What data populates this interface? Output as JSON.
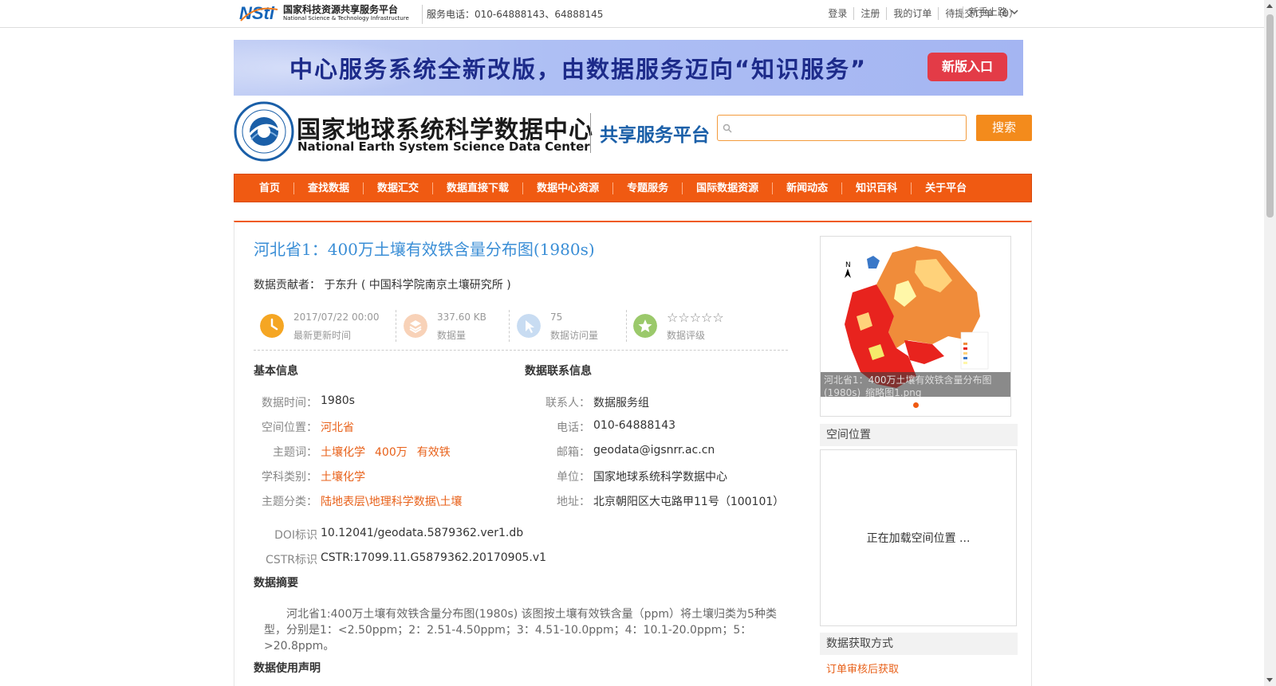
{
  "topbar": {
    "nsti_name_cn": "国家科技资源共享服务平台",
    "nsti_name_en": "National Science & Technology Infrastructure",
    "service_phone": "服务电话：010-64888143、64888145",
    "links": [
      "登录",
      "注册",
      "我的订单",
      "待提交订单（0）"
    ],
    "newbie": "新手上路"
  },
  "banner": {
    "text": "中心服务系统全新改版，由数据服务迈向“知识服务”",
    "button": "新版入口"
  },
  "header": {
    "title_cn": "国家地球系统科学数据中心",
    "title_en": "National Earth System Science Data Center",
    "platform": "共享服务平台",
    "search_placeholder": "",
    "search_button": "搜索"
  },
  "nav": [
    "首页",
    "查找数据",
    "数据汇交",
    "数据直接下载",
    "数据中心资源",
    "专题服务",
    "国际数据资源",
    "新闻动态",
    "知识百科",
    "关于平台"
  ],
  "dataset": {
    "title": "河北省1：400万土壤有效铁含量分布图(1980s)",
    "contributor": "数据贡献者： 于东升 ( 中国科学院南京土壤研究所 )",
    "stats": {
      "updated_value": "2017/07/22 00:00",
      "updated_label": "最新更新时间",
      "size_value": "337.60 KB",
      "size_label": "数据量",
      "visits_value": "75",
      "visits_label": "数据访问量",
      "stars": "☆☆☆☆☆",
      "rating_label": "数据评级"
    },
    "basic_heading": "基本信息",
    "basic": {
      "time_label": "数据时间：",
      "time": "1980s",
      "space_label": "空间位置：",
      "space": "河北省",
      "keywords_label": "主题词：",
      "keywords": [
        "土壤化学",
        "400万",
        "有效铁"
      ],
      "discipline_label": "学科类别：",
      "discipline": "土壤化学",
      "category_label": "主题分类：",
      "category": "陆地表层\\地理科学数据\\土壤",
      "doi_label": "DOI标识",
      "doi": "10.12041/geodata.5879362.ver1.db",
      "cstr_label": "CSTR标识",
      "cstr": "CSTR:17099.11.G5879362.20170905.v1"
    },
    "contact_heading": "数据联系信息",
    "contact": {
      "person_label": "联系人：",
      "person": "数据服务组",
      "phone_label": "电话：",
      "phone": "010-64888143",
      "email_label": "邮箱：",
      "email": "geodata@igsnrr.ac.cn",
      "unit_label": "单位：",
      "unit": "国家地球系统科学数据中心",
      "address_label": "地址：",
      "address": "北京朝阳区大屯路甲11号（100101）"
    },
    "abstract_heading": "数据摘要",
    "abstract": "河北省1:400万土壤有效铁含量分布图(1980s) 该图按土壤有效铁含量（ppm）将土壤归类为5种类型，分别是1：<2.50ppm；2：2.51-4.50ppm；3：4.51-10.0ppm；4：10.1-20.0ppm；5：>20.8ppm。",
    "usage_heading": "数据使用声明"
  },
  "sidebar": {
    "thumb_caption": "河北省1：400万土壤有效铁含量分布图(1980s)_缩略图1.png",
    "spatial_heading": "空间位置",
    "map_loading": "正在加载空间位置 ...",
    "access_heading": "数据获取方式",
    "access_link": "订单审核后获取"
  },
  "colors": {
    "accent": "#f05a12",
    "link_blue": "#3a8ed6",
    "orange_text": "#e8611a"
  }
}
